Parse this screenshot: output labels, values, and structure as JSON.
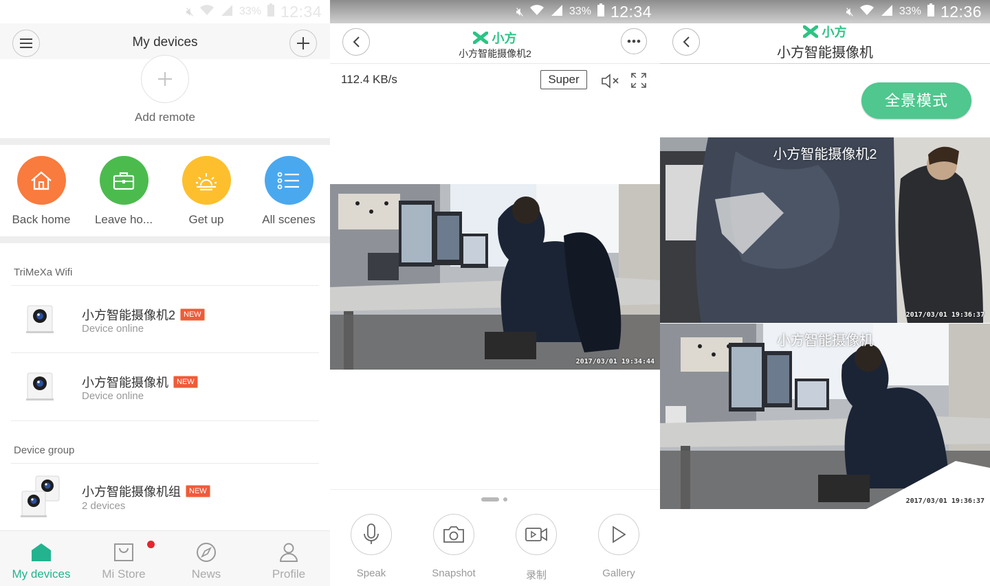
{
  "status_bars": [
    {
      "battery": "33%",
      "time": "12:34"
    },
    {
      "battery": "33%",
      "time": "12:34"
    },
    {
      "battery": "33%",
      "time": "12:36"
    }
  ],
  "devices_screen": {
    "title": "My devices",
    "add_remote": "Add remote",
    "scenes": [
      {
        "label": "Back home",
        "color": "#f97b3d"
      },
      {
        "label": "Leave ho...",
        "color": "#4cbb4e"
      },
      {
        "label": "Get up",
        "color": "#fdbf2d"
      },
      {
        "label": "All scenes",
        "color": "#4aa8ef"
      }
    ],
    "wifi_section": "TriMeXa Wifi",
    "devices": [
      {
        "name": "小方智能摄像机2",
        "badge": "NEW",
        "status": "Device online"
      },
      {
        "name": "小方智能摄像机",
        "badge": "NEW",
        "status": "Device online"
      }
    ],
    "group_section": "Device group",
    "group": {
      "name": "小方智能摄像机组",
      "badge": "NEW",
      "status": "2 devices"
    },
    "nav": [
      {
        "label": "My devices"
      },
      {
        "label": "Mi Store"
      },
      {
        "label": "News"
      },
      {
        "label": "Profile"
      }
    ],
    "accent": "#23b38e"
  },
  "camera_screen": {
    "brand": "小方",
    "subtitle": "小方智能摄像机2",
    "speed": "112.4 KB/s",
    "quality": "Super",
    "timestamp": "2017/03/01 19:34:44",
    "controls": [
      {
        "label": "Speak"
      },
      {
        "label": "Snapshot"
      },
      {
        "label": "录制"
      },
      {
        "label": "Gallery"
      }
    ]
  },
  "group_screen": {
    "brand": "小方",
    "title": "小方智能摄像机",
    "pano_button": "全景模式",
    "feeds": [
      {
        "label": "小方智能摄像机2",
        "timestamp": "2017/03/01 19:36:37"
      },
      {
        "label": "小方智能摄像机",
        "timestamp": "2017/03/01 19:36:37"
      }
    ],
    "accent": "#4fc78e"
  }
}
